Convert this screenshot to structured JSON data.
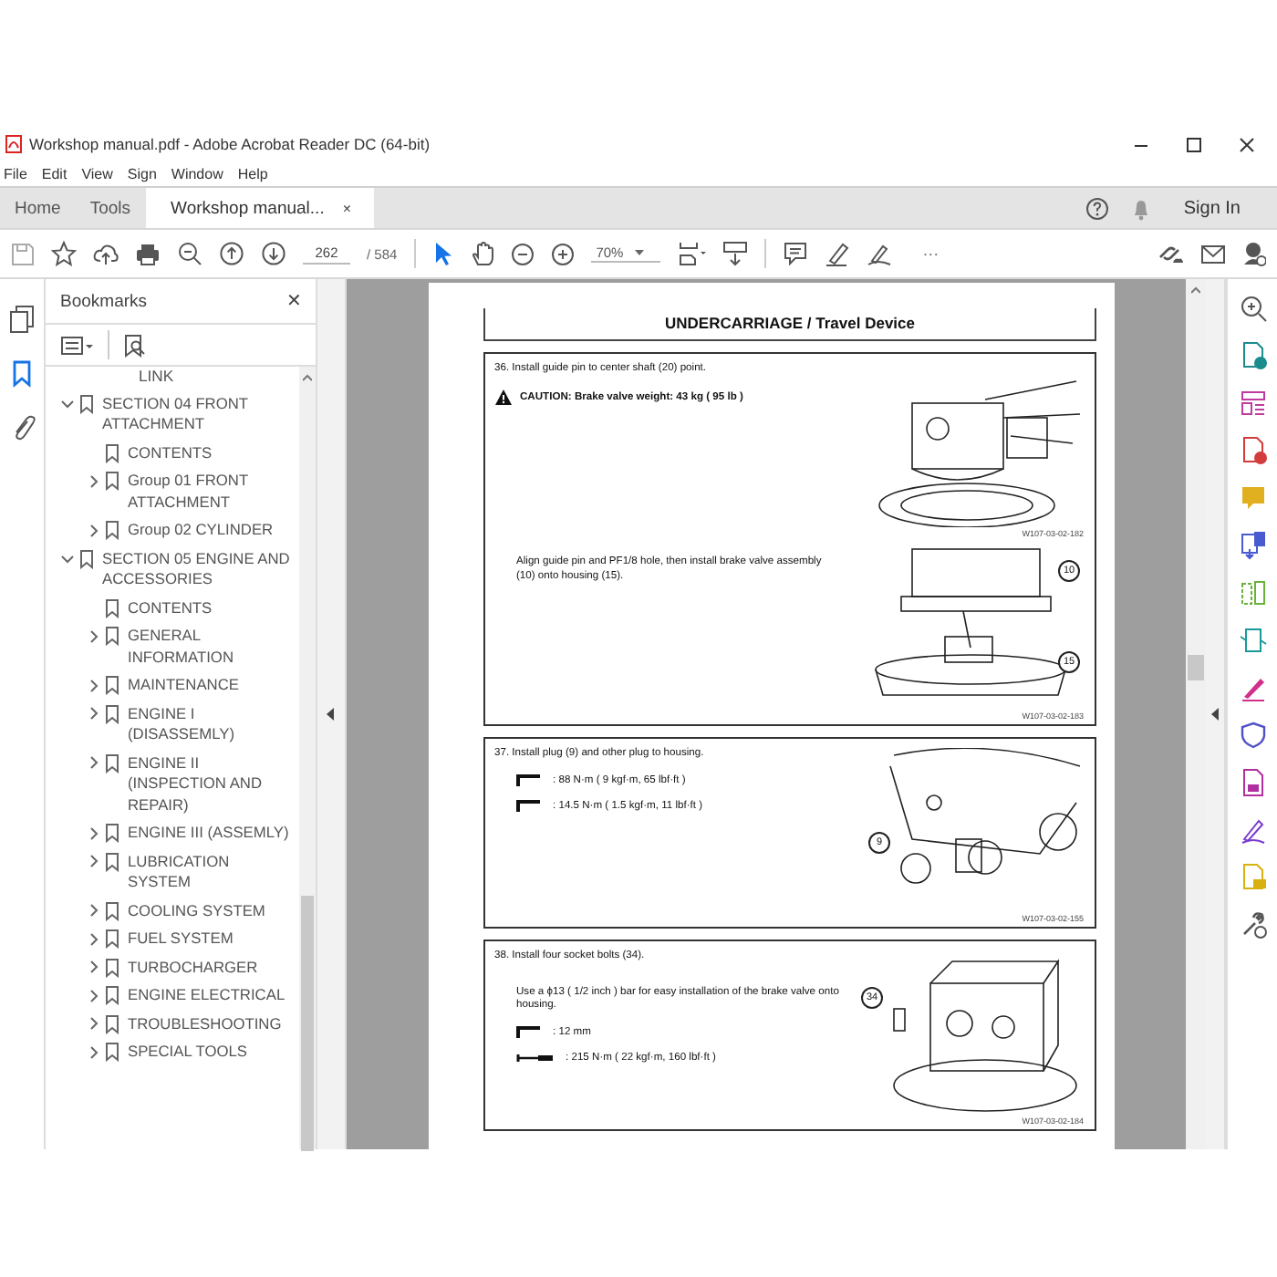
{
  "window": {
    "title": "Workshop manual.pdf - Adobe Acrobat Reader DC (64-bit)"
  },
  "menu": [
    "File",
    "Edit",
    "View",
    "Sign",
    "Window",
    "Help"
  ],
  "tabs": [
    {
      "label": "Home",
      "selected": false,
      "closable": false
    },
    {
      "label": "Tools",
      "selected": false,
      "closable": false
    },
    {
      "label": "Workshop manual...",
      "selected": true,
      "closable": true,
      "close_label": "×"
    }
  ],
  "account": {
    "sign_in": "Sign In"
  },
  "toolbar": {
    "page_current": "262",
    "page_total": "/ 584",
    "zoom": "70%",
    "more": "···",
    "select_tool_selected": true,
    "hand_tool_selected": false
  },
  "left_rail": [
    {
      "kind": "pages",
      "selected": false
    },
    {
      "kind": "bookmarks",
      "selected": true
    },
    {
      "kind": "attachments",
      "selected": false
    }
  ],
  "bookmarks": {
    "title": "Bookmarks",
    "close_label": "✕",
    "cut_item": "LINK",
    "items": [
      {
        "label": "SECTION 04 FRONT ATTACHMENT",
        "expanded": true,
        "children": [
          {
            "label": "CONTENTS"
          },
          {
            "label": "Group 01 FRONT ATTACHMENT",
            "expanded": false
          },
          {
            "label": "Group 02 CYLINDER",
            "expanded": false
          }
        ]
      },
      {
        "label": "SECTION 05 ENGINE AND ACCESSORIES",
        "expanded": true,
        "children": [
          {
            "label": "CONTENTS"
          },
          {
            "label": "GENERAL INFORMATION",
            "expanded": false
          },
          {
            "label": "MAINTENANCE",
            "expanded": false
          },
          {
            "label": "ENGINE I (DISASSEMLY)",
            "expanded": false
          },
          {
            "label": "ENGINE II (INSPECTION AND REPAIR)",
            "expanded": false
          },
          {
            "label": "ENGINE III (ASSEMLY)",
            "expanded": false
          },
          {
            "label": "LUBRICATION SYSTEM",
            "expanded": false
          },
          {
            "label": "COOLING SYSTEM",
            "expanded": false
          },
          {
            "label": "FUEL SYSTEM",
            "expanded": false
          },
          {
            "label": "TURBOCHARGER",
            "expanded": false
          },
          {
            "label": "ENGINE ELECTRICAL",
            "expanded": false
          },
          {
            "label": "TROUBLESHOOTING",
            "expanded": false
          },
          {
            "label": "SPECIAL TOOLS",
            "expanded": false
          }
        ]
      }
    ]
  },
  "document": {
    "heading": "UNDERCARRIAGE / Travel Device",
    "steps": [
      {
        "blocks": [
          {
            "lines": [
              {
                "kind": "text",
                "text": "36. Install guide pin to center shaft (20) point."
              },
              {
                "kind": "caution",
                "text": "CAUTION: Brake valve weight: 43  kg ( 95  lb )"
              }
            ],
            "figure": {
              "kind": "motor",
              "code": "W107-03-02-182"
            }
          },
          {
            "lines": [
              {
                "kind": "indent",
                "text": "Align guide pin and PF1/8 hole, then install brake valve assembly (10) onto housing (15)."
              }
            ],
            "figure": {
              "kind": "housing",
              "callouts": [
                "10",
                "15"
              ],
              "code": "W107-03-02-183"
            }
          }
        ]
      },
      {
        "blocks": [
          {
            "lines": [
              {
                "kind": "text",
                "text": "37. Install plug (9) and other plug to housing."
              },
              {
                "kind": "wrench",
                "text": ": 88  N·m ( 9  kgf·m, 65  lbf·ft )"
              },
              {
                "kind": "wrench",
                "text": ": 14.5  N·m ( 1.5  kgf·m, 11  lbf·ft )"
              }
            ],
            "figure": {
              "kind": "plug",
              "callouts": [
                "9"
              ],
              "code": "W107-03-02-155"
            }
          }
        ]
      },
      {
        "blocks": [
          {
            "lines": [
              {
                "kind": "text",
                "text": "38. Install four socket bolts (34)."
              },
              {
                "kind": "indent",
                "text": "Use a ϕ13 ( 1/2  inch ) bar for easy installation of the brake valve onto housing."
              },
              {
                "kind": "wrench",
                "text": ": 12  mm"
              },
              {
                "kind": "torque",
                "text": ": 215  N·m ( 22  kgf·m, 160  lbf·ft )"
              }
            ],
            "figure": {
              "kind": "valve",
              "callouts": [
                "34"
              ],
              "code": "W107-03-02-184"
            }
          }
        ]
      }
    ]
  }
}
